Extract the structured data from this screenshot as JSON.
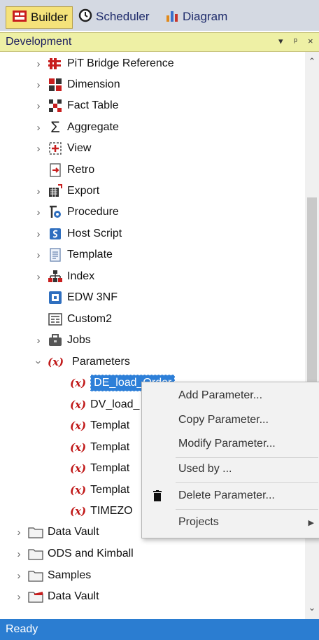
{
  "tabs": [
    {
      "label": "Builder",
      "icon": "builder-icon",
      "active": true
    },
    {
      "label": "Scheduler",
      "icon": "clock-icon",
      "active": false
    },
    {
      "label": "Diagram",
      "icon": "bar-chart-icon",
      "active": false
    }
  ],
  "panel": {
    "title": "Development",
    "controls": [
      "▾",
      "ᵖ",
      "×"
    ]
  },
  "tree": {
    "items": [
      {
        "label": "PiT Bridge Reference",
        "icon": "pit-bridge-icon"
      },
      {
        "label": "Dimension",
        "icon": "dimension-icon"
      },
      {
        "label": "Fact Table",
        "icon": "fact-table-icon"
      },
      {
        "label": "Aggregate",
        "icon": "sigma-icon"
      },
      {
        "label": "View",
        "icon": "view-icon"
      },
      {
        "label": "Retro",
        "icon": "retro-icon"
      },
      {
        "label": "Export",
        "icon": "export-icon"
      },
      {
        "label": "Procedure",
        "icon": "procedure-icon"
      },
      {
        "label": "Host Script",
        "icon": "host-script-icon"
      },
      {
        "label": "Template",
        "icon": "template-icon"
      },
      {
        "label": "Index",
        "icon": "index-icon"
      },
      {
        "label": "EDW 3NF",
        "icon": "edw-icon"
      },
      {
        "label": "Custom2",
        "icon": "custom-icon"
      },
      {
        "label": "Jobs",
        "icon": "jobs-icon"
      },
      {
        "label": "Parameters",
        "icon": "parameter-icon"
      }
    ],
    "parameters": [
      {
        "label": "DE_load_Order",
        "selected": true
      },
      {
        "label": "DV_load_"
      },
      {
        "label": "Templat"
      },
      {
        "label": "Templat"
      },
      {
        "label": "Templat"
      },
      {
        "label": "Templat"
      },
      {
        "label": "TIMEZO"
      }
    ],
    "folders": [
      {
        "label": "Data Vault",
        "icon": "folder-icon"
      },
      {
        "label": "ODS and Kimball",
        "icon": "folder-icon"
      },
      {
        "label": "Samples",
        "icon": "folder-icon"
      },
      {
        "label": "Data Vault",
        "icon": "folder-red-icon"
      }
    ]
  },
  "context_menu": {
    "items": [
      {
        "label": "Add Parameter..."
      },
      {
        "label": "Copy Parameter..."
      },
      {
        "label": "Modify Parameter..."
      },
      {
        "label": "Used by ..."
      },
      {
        "label": "Delete Parameter...",
        "icon": "trash-icon"
      },
      {
        "label": "Projects",
        "submenu": true
      }
    ]
  },
  "status": {
    "text": "Ready"
  }
}
